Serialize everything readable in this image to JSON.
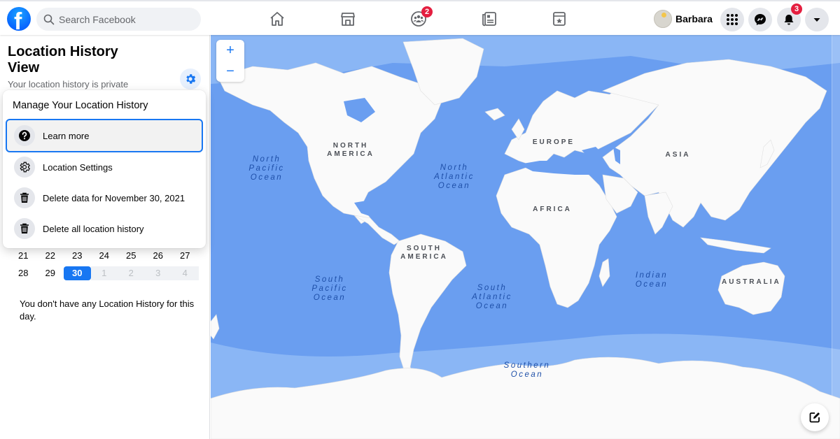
{
  "header": {
    "logo_letter": "f",
    "search_placeholder": "Search Facebook",
    "nav": [
      {
        "name": "home",
        "icon": "home-icon"
      },
      {
        "name": "marketplace",
        "icon": "marketplace-icon"
      },
      {
        "name": "groups",
        "icon": "groups-icon",
        "badge": "2"
      },
      {
        "name": "news",
        "icon": "news-icon"
      },
      {
        "name": "saved",
        "icon": "saved-icon"
      }
    ],
    "profile_name": "Barbara",
    "notifications_badge": "3"
  },
  "left_panel": {
    "title": "Location History View",
    "subtitle": "Your location history is private",
    "menu": {
      "title": "Manage Your Location History",
      "items": [
        {
          "label": "Learn more",
          "icon": "question-icon",
          "active": true
        },
        {
          "label": "Location Settings",
          "icon": "gear-icon",
          "active": false
        },
        {
          "label": "Delete data for November 30, 2021",
          "icon": "trash-icon",
          "active": false
        },
        {
          "label": "Delete all location history",
          "icon": "trash-icon",
          "active": false
        }
      ]
    },
    "calendar": {
      "rows": [
        [
          {
            "d": "21"
          },
          {
            "d": "22"
          },
          {
            "d": "23"
          },
          {
            "d": "24"
          },
          {
            "d": "25"
          },
          {
            "d": "26"
          },
          {
            "d": "27"
          }
        ],
        [
          {
            "d": "28"
          },
          {
            "d": "29"
          },
          {
            "d": "30",
            "selected": true
          },
          {
            "d": "1",
            "other": true
          },
          {
            "d": "2",
            "other": true
          },
          {
            "d": "3",
            "other": true
          },
          {
            "d": "4",
            "other": true
          }
        ]
      ]
    },
    "empty_message": "You don't have any Location History for this day."
  },
  "map": {
    "zoom_in": "+",
    "zoom_out": "−",
    "continents": [
      "NORTH AMERICA",
      "EUROPE",
      "ASIA",
      "AFRICA",
      "SOUTH AMERICA",
      "AUSTRALIA"
    ],
    "oceans": {
      "north_pacific": "North Pacific Ocean",
      "north_atlantic": "North Atlantic Ocean",
      "south_pacific": "South Pacific Ocean",
      "south_atlantic": "South Atlantic Ocean",
      "indian": "Indian Ocean",
      "southern": "Southern Ocean"
    },
    "colors": {
      "ocean": "#6a9ef0",
      "shelf": "#8ab6f5",
      "land": "#fafafa"
    }
  }
}
